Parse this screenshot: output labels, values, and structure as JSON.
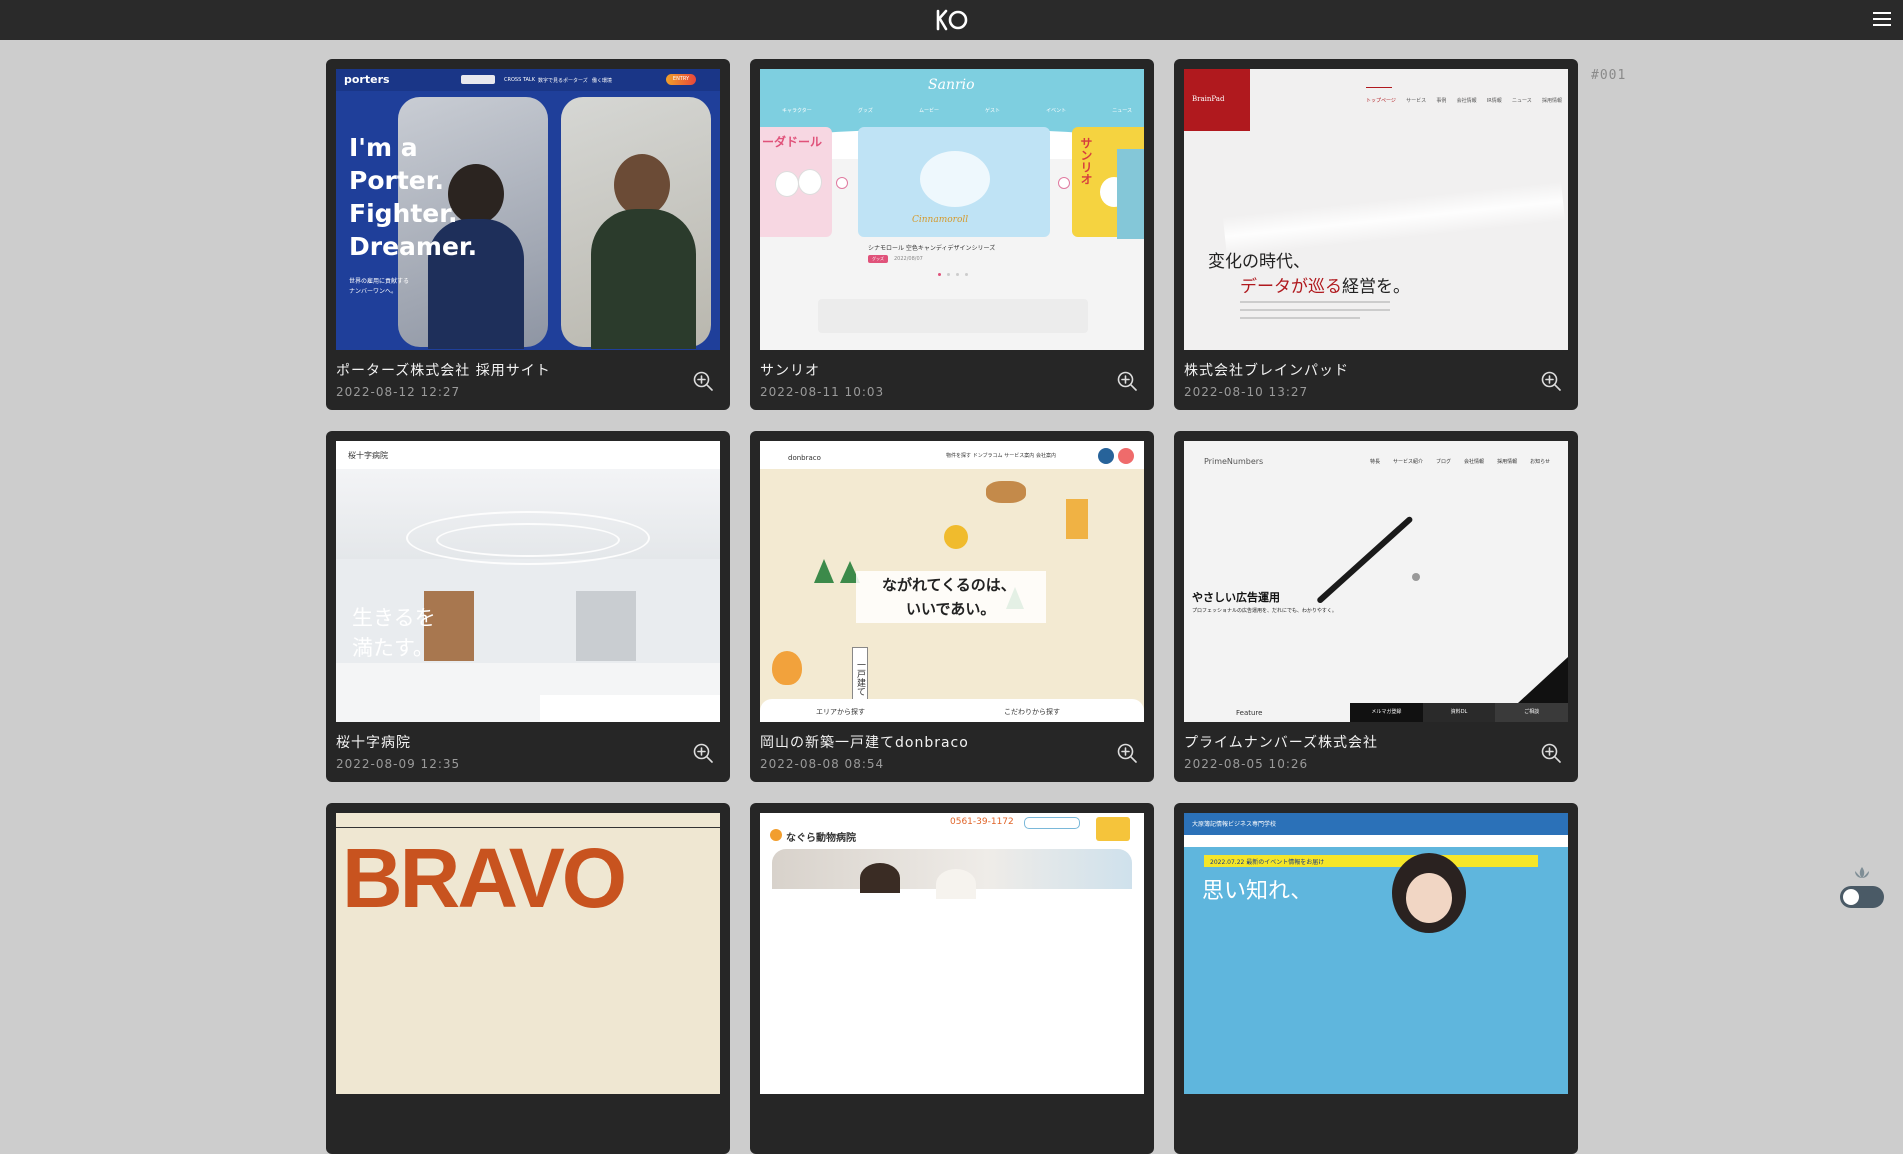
{
  "header": {
    "logo_icon": "ko-logo-icon",
    "menu_icon": "hamburger-menu-icon"
  },
  "counter": "#001",
  "cards": [
    {
      "title": "ポーターズ株式会社 採用サイト",
      "date": "2022-08-12 12:27",
      "thumb": {
        "brand": "porters",
        "nav": [
          "CROSS TALK",
          "数字で見るポーターズ",
          "働く環境"
        ],
        "entry": "ENTRY",
        "headline": [
          "I'm a",
          "Porter.",
          "Fighter.",
          "Dreamer."
        ],
        "sub": [
          "世界の雇用に貢献する",
          "ナンバーワンへ。"
        ]
      }
    },
    {
      "title": "サンリオ",
      "date": "2022-08-11 10:03",
      "thumb": {
        "brand": "Sanrio",
        "nav": [
          "キャラクター",
          "グッズ",
          "ムービー",
          "ゲスト",
          "イベント",
          "ニュース"
        ],
        "left_label": "ーダドール",
        "right_label": "サンリオ",
        "product": "シナモロール 空色キャンディデザインシリーズ",
        "tag": "グッズ",
        "product_date": "2022/08/07",
        "char_name": "Cinnamoroll"
      }
    },
    {
      "title": "株式会社ブレインパッド",
      "date": "2022-08-10 13:27",
      "thumb": {
        "brand": "BrainPad",
        "nav": [
          "トップページ",
          "サービス",
          "事例",
          "会社情報",
          "IR情報",
          "ニュース",
          "採用情報"
        ],
        "headline1": "変化の時代、",
        "headline2a": "データが巡る",
        "headline2b": "経営を。"
      }
    },
    {
      "title": "桜十字病院",
      "date": "2022-08-09 12:35",
      "thumb": {
        "brand": "桜十字病院",
        "headline": [
          "生きるを",
          "満たす。"
        ]
      }
    },
    {
      "title": "岡山の新築一戸建てdonbraco",
      "date": "2022-08-08 08:54",
      "thumb": {
        "brand": "donbraco",
        "nav": [
          "物件を探す",
          "ドンブラコム",
          "サービス案内",
          "会社案内"
        ],
        "headline": [
          "ながれてくるのは、",
          "いいであい。"
        ],
        "sign": "一戸建て",
        "btn1": "エリアから探す",
        "btn2": "こだわりから探す"
      }
    },
    {
      "title": "プライムナンバーズ株式会社",
      "date": "2022-08-05 10:26",
      "thumb": {
        "brand": "PrimeNumbers",
        "nav": [
          "特長",
          "サービス紹介",
          "ブログ",
          "会社情報",
          "採用情報",
          "お知らせ"
        ],
        "headline": "やさしい広告運用",
        "sub": "プロフェッショナルの広告運用を、だれにでも、わかりやすく。",
        "feature": "Feature",
        "bar": [
          "メルマガ登録",
          "資料DL",
          "ご相談"
        ]
      }
    },
    {
      "title": "",
      "date": "",
      "thumb": {
        "brand": "BRAVO"
      }
    },
    {
      "title": "",
      "date": "",
      "thumb": {
        "brand": "なぐら動物病院",
        "phone": "0561-39-1172"
      }
    },
    {
      "title": "",
      "date": "",
      "thumb": {
        "brand": "大原簿記情報ビジネス専門学校",
        "headline": "思い知れ、",
        "banner": "2022.07.22 最新のイベント情報をお届け"
      }
    }
  ],
  "colors": {
    "background": "#cdcdcd",
    "topbar": "#2a2a2a",
    "card": "#262626",
    "bravo_orange": "#c8531f",
    "brainpad_red": "#b0191e"
  },
  "theme_toggle": {
    "state": "off",
    "icon": "lotus-icon"
  }
}
